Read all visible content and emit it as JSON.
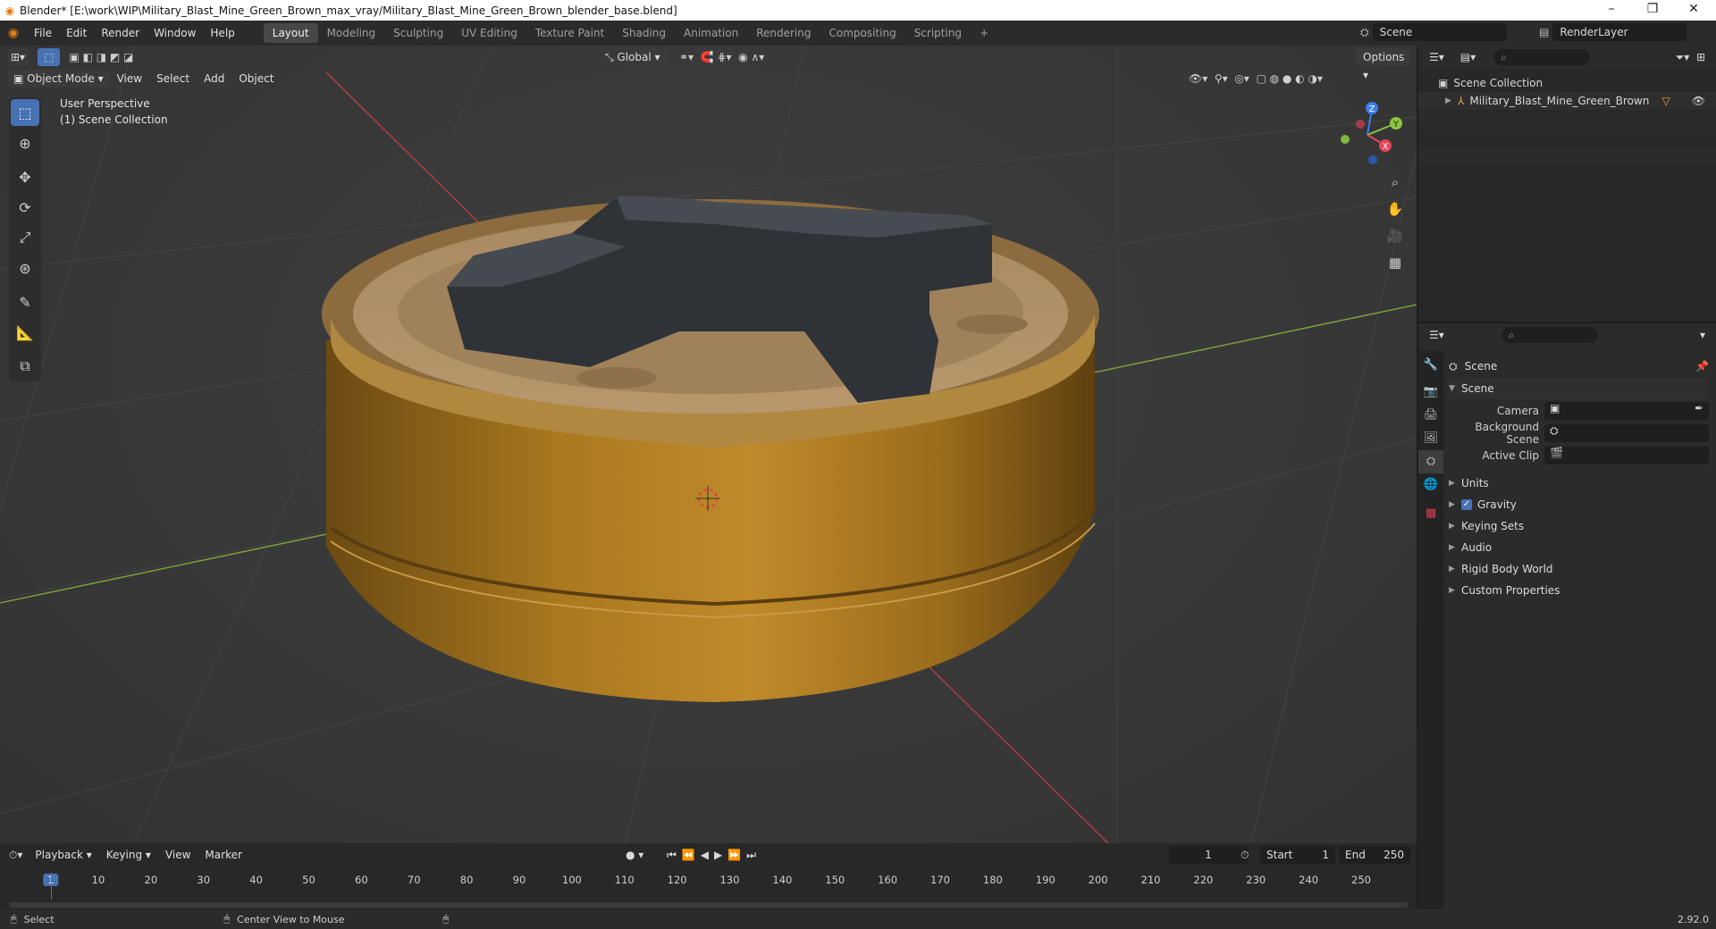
{
  "window": {
    "title": "Blender* [E:\\work\\WIP\\Military_Blast_Mine_Green_Brown_max_vray/Military_Blast_Mine_Green_Brown_blender_base.blend]",
    "controls": [
      "–",
      "❐",
      "✕"
    ]
  },
  "menu": [
    "File",
    "Edit",
    "Render",
    "Window",
    "Help"
  ],
  "workspaces": [
    "Layout",
    "Modeling",
    "Sculpting",
    "UV Editing",
    "Texture Paint",
    "Shading",
    "Animation",
    "Rendering",
    "Compositing",
    "Scripting"
  ],
  "active_workspace": "Layout",
  "add_workspace": "+",
  "scene_selector": {
    "value": "Scene"
  },
  "render_layer": {
    "value": "RenderLayer"
  },
  "viewport": {
    "mode": "Object Mode",
    "header_menus": [
      "View",
      "Select",
      "Add",
      "Object"
    ],
    "transform_orientation": "Global",
    "options_label": "Options",
    "overlay_title": "User Perspective",
    "overlay_subtitle": "(1) Scene Collection",
    "gizmo_axes": {
      "z": "Z",
      "y": "Y",
      "x": "X"
    }
  },
  "outliner": {
    "root": "Scene Collection",
    "items": [
      "Military_Blast_Mine_Green_Brown"
    ]
  },
  "properties": {
    "context_title": "Scene",
    "section": "Scene",
    "fields": [
      {
        "label": "Camera"
      },
      {
        "label": "Background Scene"
      },
      {
        "label": "Active Clip"
      }
    ],
    "panels": [
      {
        "label": "Units",
        "checkbox": false
      },
      {
        "label": "Gravity",
        "checkbox": true,
        "checked": true
      },
      {
        "label": "Keying Sets",
        "checkbox": false
      },
      {
        "label": "Audio",
        "checkbox": false
      },
      {
        "label": "Rigid Body World",
        "checkbox": false
      },
      {
        "label": "Custom Properties",
        "checkbox": false
      }
    ]
  },
  "timeline": {
    "menus": [
      "Playback",
      "Keying",
      "View",
      "Marker"
    ],
    "current_frame": "1",
    "start_label": "Start",
    "start": "1",
    "end_label": "End",
    "end": "250",
    "ticks": [
      "1",
      "10",
      "20",
      "30",
      "40",
      "50",
      "60",
      "70",
      "80",
      "90",
      "100",
      "110",
      "120",
      "130",
      "140",
      "150",
      "160",
      "170",
      "180",
      "190",
      "200",
      "210",
      "220",
      "230",
      "240",
      "250"
    ]
  },
  "statusbar": {
    "select": "Select",
    "center_view": "Center View to Mouse",
    "version": "2.92.0"
  },
  "colors": {
    "accent": "#4772b3",
    "active_frame": "#4772b3",
    "x_axis": "#e8445a",
    "y_axis": "#8bc53f",
    "z_axis": "#3b7ded"
  }
}
